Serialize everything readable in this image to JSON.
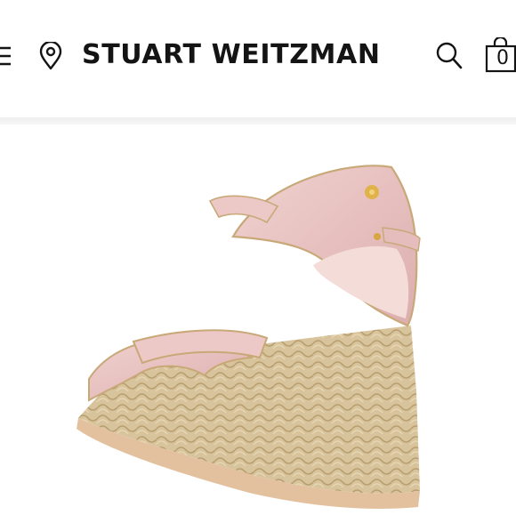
{
  "header": {
    "brand": "STUART WEITZMAN",
    "bag_count": "0",
    "icons": {
      "menu": "hamburger-menu-icon",
      "location": "map-pin-icon",
      "search": "magnifier-icon",
      "bag": "shopping-bag-icon"
    }
  },
  "product": {
    "image_subject": "pink espadrille wedge sandal",
    "colors": {
      "upper": "#ecc8c6",
      "upper_shadow": "#d9a9a9",
      "trim": "#c9a878",
      "jute": "#d8c49c",
      "sole": "#e3c19f",
      "charm": "#e0b24a"
    }
  }
}
